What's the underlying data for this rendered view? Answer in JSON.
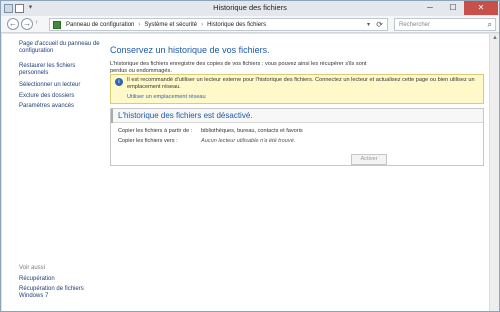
{
  "window": {
    "title": "Historique des fichiers",
    "minimize": "─",
    "maximize": "☐",
    "close": "✕"
  },
  "nav": {
    "back": "←",
    "forward": "→",
    "up": "↑",
    "dropdown_glyph": "▾",
    "refresh_glyph": "⟳"
  },
  "breadcrumb": [
    "Panneau de configuration",
    "Système et sécurité",
    "Historique des fichiers"
  ],
  "search": {
    "placeholder": "Rechercher",
    "icon": "search-icon"
  },
  "sidebar": {
    "home_link": "Page d'accueil du panneau de configuration",
    "links": [
      "Restaurer les fichiers personnels",
      "Sélectionner un lecteur",
      "Exclure des dossiers",
      "Paramètres avancés"
    ],
    "see_also": "Voir aussi",
    "bottom_links": [
      "Récupération",
      "Récupération de fichiers Windows 7"
    ]
  },
  "main": {
    "heading": "Conservez un historique de vos fichiers.",
    "description": "L'historique des fichiers enregistre des copies de vos fichiers ; vous pouvez ainsi les récupérer s'ils sont perdus ou endommagés.",
    "info": {
      "icon": "info-icon",
      "text": "Il est recommandé d'utiliser un lecteur externe pour l'historique des fichiers. Connectez un lecteur et actualisez cette page ou bien utilisez un emplacement réseau.",
      "link": "Utiliser un emplacement réseau"
    },
    "status": {
      "title": "L'historique des fichiers est désactivé.",
      "rows": [
        {
          "label": "Copier les fichiers à partir de :",
          "value": "bibliothèques, bureau, contacts et favoris"
        },
        {
          "label": "Copier les fichiers vers :",
          "value": "Aucun lecteur utilisable n'a été trouvé."
        }
      ]
    },
    "activate_button": "Activer"
  },
  "colors": {
    "accent": "#1d5aa8",
    "link": "#1f3f7a",
    "info_background": "#fff9c9",
    "close_button": "#c7504a"
  }
}
